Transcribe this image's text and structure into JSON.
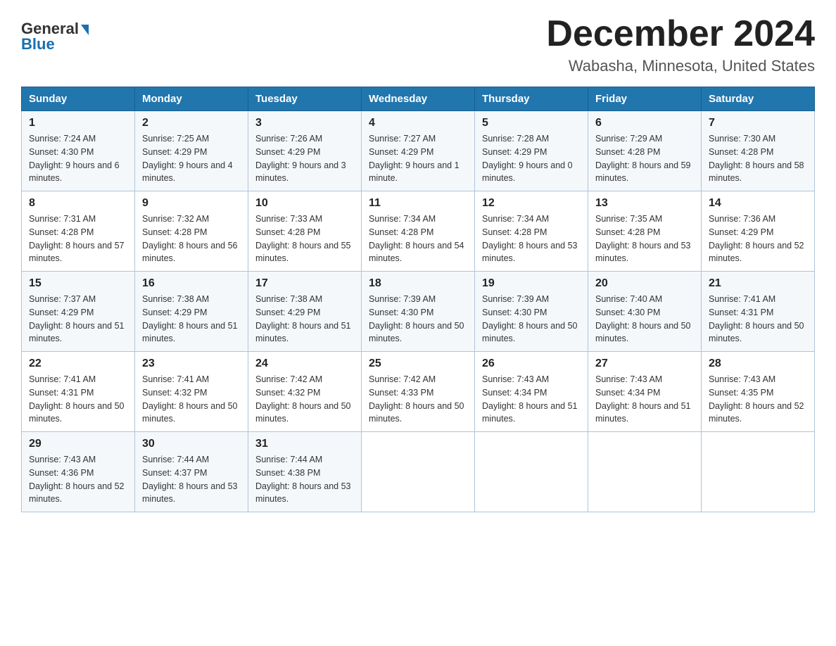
{
  "logo": {
    "general": "General",
    "blue": "Blue"
  },
  "title": "December 2024",
  "location": "Wabasha, Minnesota, United States",
  "days_of_week": [
    "Sunday",
    "Monday",
    "Tuesday",
    "Wednesday",
    "Thursday",
    "Friday",
    "Saturday"
  ],
  "weeks": [
    [
      {
        "day": "1",
        "sunrise": "7:24 AM",
        "sunset": "4:30 PM",
        "daylight": "9 hours and 6 minutes."
      },
      {
        "day": "2",
        "sunrise": "7:25 AM",
        "sunset": "4:29 PM",
        "daylight": "9 hours and 4 minutes."
      },
      {
        "day": "3",
        "sunrise": "7:26 AM",
        "sunset": "4:29 PM",
        "daylight": "9 hours and 3 minutes."
      },
      {
        "day": "4",
        "sunrise": "7:27 AM",
        "sunset": "4:29 PM",
        "daylight": "9 hours and 1 minute."
      },
      {
        "day": "5",
        "sunrise": "7:28 AM",
        "sunset": "4:29 PM",
        "daylight": "9 hours and 0 minutes."
      },
      {
        "day": "6",
        "sunrise": "7:29 AM",
        "sunset": "4:28 PM",
        "daylight": "8 hours and 59 minutes."
      },
      {
        "day": "7",
        "sunrise": "7:30 AM",
        "sunset": "4:28 PM",
        "daylight": "8 hours and 58 minutes."
      }
    ],
    [
      {
        "day": "8",
        "sunrise": "7:31 AM",
        "sunset": "4:28 PM",
        "daylight": "8 hours and 57 minutes."
      },
      {
        "day": "9",
        "sunrise": "7:32 AM",
        "sunset": "4:28 PM",
        "daylight": "8 hours and 56 minutes."
      },
      {
        "day": "10",
        "sunrise": "7:33 AM",
        "sunset": "4:28 PM",
        "daylight": "8 hours and 55 minutes."
      },
      {
        "day": "11",
        "sunrise": "7:34 AM",
        "sunset": "4:28 PM",
        "daylight": "8 hours and 54 minutes."
      },
      {
        "day": "12",
        "sunrise": "7:34 AM",
        "sunset": "4:28 PM",
        "daylight": "8 hours and 53 minutes."
      },
      {
        "day": "13",
        "sunrise": "7:35 AM",
        "sunset": "4:28 PM",
        "daylight": "8 hours and 53 minutes."
      },
      {
        "day": "14",
        "sunrise": "7:36 AM",
        "sunset": "4:29 PM",
        "daylight": "8 hours and 52 minutes."
      }
    ],
    [
      {
        "day": "15",
        "sunrise": "7:37 AM",
        "sunset": "4:29 PM",
        "daylight": "8 hours and 51 minutes."
      },
      {
        "day": "16",
        "sunrise": "7:38 AM",
        "sunset": "4:29 PM",
        "daylight": "8 hours and 51 minutes."
      },
      {
        "day": "17",
        "sunrise": "7:38 AM",
        "sunset": "4:29 PM",
        "daylight": "8 hours and 51 minutes."
      },
      {
        "day": "18",
        "sunrise": "7:39 AM",
        "sunset": "4:30 PM",
        "daylight": "8 hours and 50 minutes."
      },
      {
        "day": "19",
        "sunrise": "7:39 AM",
        "sunset": "4:30 PM",
        "daylight": "8 hours and 50 minutes."
      },
      {
        "day": "20",
        "sunrise": "7:40 AM",
        "sunset": "4:30 PM",
        "daylight": "8 hours and 50 minutes."
      },
      {
        "day": "21",
        "sunrise": "7:41 AM",
        "sunset": "4:31 PM",
        "daylight": "8 hours and 50 minutes."
      }
    ],
    [
      {
        "day": "22",
        "sunrise": "7:41 AM",
        "sunset": "4:31 PM",
        "daylight": "8 hours and 50 minutes."
      },
      {
        "day": "23",
        "sunrise": "7:41 AM",
        "sunset": "4:32 PM",
        "daylight": "8 hours and 50 minutes."
      },
      {
        "day": "24",
        "sunrise": "7:42 AM",
        "sunset": "4:32 PM",
        "daylight": "8 hours and 50 minutes."
      },
      {
        "day": "25",
        "sunrise": "7:42 AM",
        "sunset": "4:33 PM",
        "daylight": "8 hours and 50 minutes."
      },
      {
        "day": "26",
        "sunrise": "7:43 AM",
        "sunset": "4:34 PM",
        "daylight": "8 hours and 51 minutes."
      },
      {
        "day": "27",
        "sunrise": "7:43 AM",
        "sunset": "4:34 PM",
        "daylight": "8 hours and 51 minutes."
      },
      {
        "day": "28",
        "sunrise": "7:43 AM",
        "sunset": "4:35 PM",
        "daylight": "8 hours and 52 minutes."
      }
    ],
    [
      {
        "day": "29",
        "sunrise": "7:43 AM",
        "sunset": "4:36 PM",
        "daylight": "8 hours and 52 minutes."
      },
      {
        "day": "30",
        "sunrise": "7:44 AM",
        "sunset": "4:37 PM",
        "daylight": "8 hours and 53 minutes."
      },
      {
        "day": "31",
        "sunrise": "7:44 AM",
        "sunset": "4:38 PM",
        "daylight": "8 hours and 53 minutes."
      },
      null,
      null,
      null,
      null
    ]
  ],
  "labels": {
    "sunrise": "Sunrise:",
    "sunset": "Sunset:",
    "daylight": "Daylight:"
  }
}
